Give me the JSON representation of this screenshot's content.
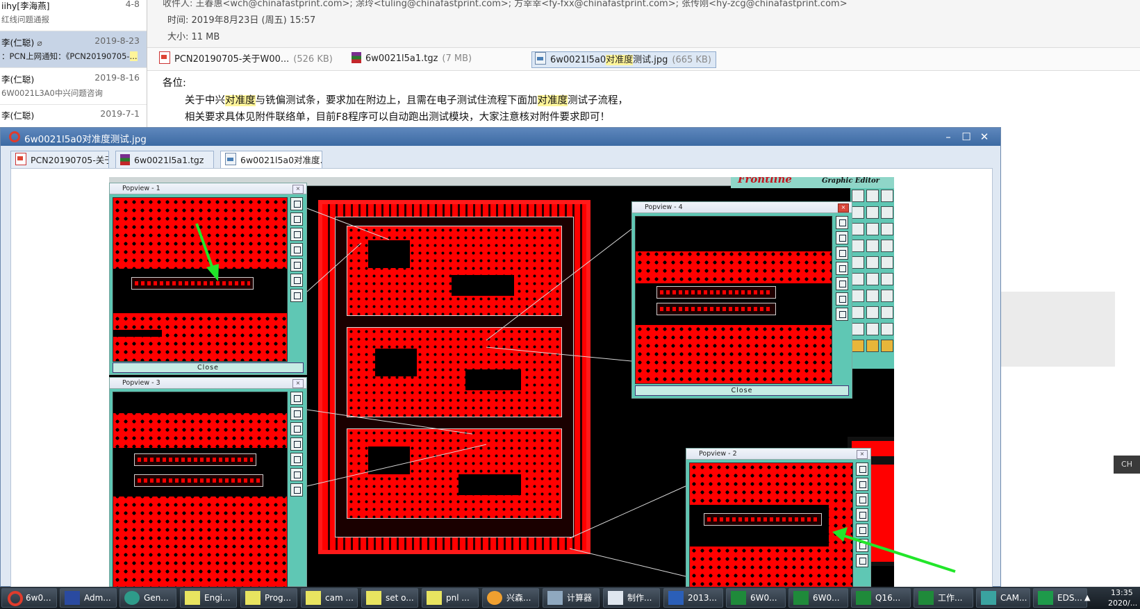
{
  "mail_list": {
    "items": [
      {
        "sender": "iihy[李海燕]",
        "date": "4-8",
        "subject": "红线问题通报"
      },
      {
        "sender": "李(仁聪)",
        "date": "2019-8-23",
        "subject_prefix": "：PCN上网通知：《PCN20190705-",
        "subject_hl": "...",
        "selected": true
      },
      {
        "sender": "李(仁聪)",
        "date": "2019-8-16",
        "subject": "6W0021L3A0中兴问题咨询"
      },
      {
        "sender": "李(仁聪)",
        "date": "2019-7-1",
        "subject": ""
      }
    ]
  },
  "header": {
    "recipients": "收件人: 王春惠<wch@chinafastprint.com>; 涂玲<tuling@chinafastprint.com>; 方幸幸<fy-fxx@chinafastprint.com>; 张传刚<hy-zcg@chinafastprint.com>",
    "time": "时间: 2019年8月23日 (周五) 15:57",
    "size": "大小: 11 MB"
  },
  "attachments": [
    {
      "name": "PCN20190705-关于W00...",
      "size": "(526 KB)",
      "icon": "pdf-file-icon"
    },
    {
      "name": "6w0021l5a1.tgz",
      "size": "(7 MB)",
      "icon": "archive-file-icon"
    },
    {
      "name_pre": "6w0021l5a0",
      "name_hl": "对准度",
      "name_post": "测试.jpg",
      "size": "(665 KB)",
      "icon": "image-file-icon",
      "selected": true
    }
  ],
  "body": {
    "greeting": "各位:",
    "line1": [
      {
        "t": "关于中兴",
        "hl": false
      },
      {
        "t": "对准度",
        "hl": true
      },
      {
        "t": "与铣偏测试条，要求加在附边上，且需在电子测试住流程下面加",
        "hl": false
      },
      {
        "t": "对准度",
        "hl": true
      },
      {
        "t": "测试子流程，",
        "hl": false
      }
    ],
    "line2": "相关要求具体见附件联络单，目前F8程序可以自动跑出测试模块，大家注意核对附件要求即可！"
  },
  "viewer": {
    "title": "6w0021l5a0对准度测试.jpg",
    "tabs": [
      {
        "label": "PCN20190705-关于...",
        "icon": "pdf-file-icon"
      },
      {
        "label": "6w0021l5a1.tgz",
        "icon": "archive-file-icon"
      },
      {
        "label": "6w0021l5a0对准度...",
        "icon": "image-file-icon",
        "active": true
      }
    ]
  },
  "image": {
    "brand": "Frontline",
    "editor_label": "Graphic Editor",
    "popviews": [
      {
        "title": "Popview - 1",
        "close_label": "Close"
      },
      {
        "title": "Popview - 3"
      },
      {
        "title": "Popview - 4",
        "close_label": "Close"
      },
      {
        "title": "Popview - 2"
      }
    ]
  },
  "language_badge": "CH",
  "taskbar": {
    "items": [
      {
        "label": "6w0...",
        "icon": "viewer-app-icon"
      },
      {
        "label": "Adm...",
        "icon": "floppy-icon"
      },
      {
        "label": "Gen...",
        "icon": "genesis-icon"
      },
      {
        "label": "Engi...",
        "icon": "x-window-icon"
      },
      {
        "label": "Prog...",
        "icon": "x-window-icon"
      },
      {
        "label": "cam ...",
        "icon": "x-window-icon"
      },
      {
        "label": "set o...",
        "icon": "x-window-icon"
      },
      {
        "label": "pnl ...",
        "icon": "x-window-icon"
      },
      {
        "label": "兴森...",
        "icon": "shell-icon"
      },
      {
        "label": "计算器",
        "icon": "calculator-icon"
      },
      {
        "label": "制作...",
        "icon": "notepad-icon"
      },
      {
        "label": "2013...",
        "icon": "word-icon"
      },
      {
        "label": "6W0...",
        "icon": "excel-icon"
      },
      {
        "label": "6W0...",
        "icon": "excel-icon"
      },
      {
        "label": "Q16...",
        "icon": "excel-icon"
      },
      {
        "label": "工作...",
        "icon": "excel-icon"
      },
      {
        "label": "CAM...",
        "icon": "cam-icon"
      },
      {
        "label": "EDS...",
        "icon": "eds-icon"
      }
    ],
    "clock_time": "13:35",
    "clock_date": "2020/..."
  },
  "colors": {
    "accent_title": "#3c6aa3",
    "highlight": "#fff59a",
    "pcb_red": "#ff0000",
    "popview_teal": "#5fc7b4",
    "arrow_green": "#22e62a"
  }
}
